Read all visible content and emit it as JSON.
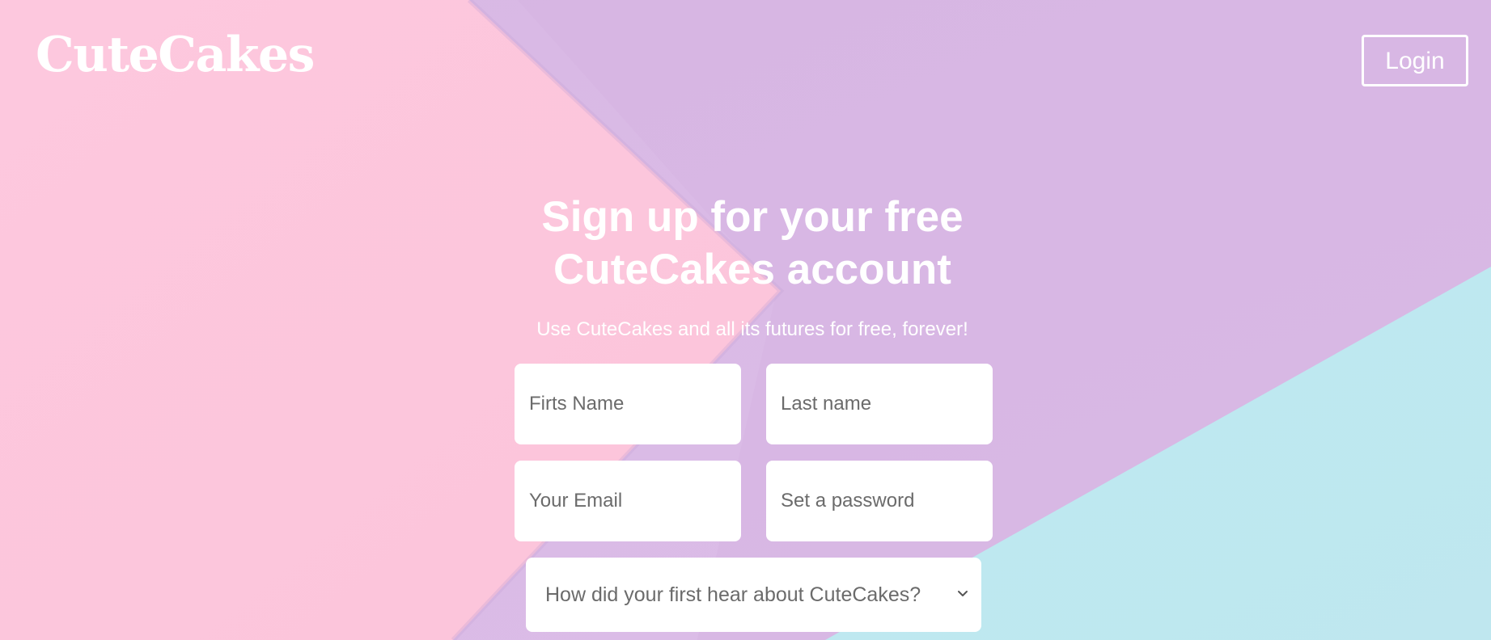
{
  "brand": {
    "logo_text": "CuteCakes"
  },
  "header": {
    "login_label": "Login"
  },
  "hero": {
    "headline": "Sign up for your free CuteCakes account",
    "subtitle": "Use CuteCakes and all its futures for free, forever!"
  },
  "form": {
    "first_name": {
      "placeholder": "Firts Name",
      "value": ""
    },
    "last_name": {
      "placeholder": "Last name",
      "value": ""
    },
    "email": {
      "placeholder": "Your Email",
      "value": ""
    },
    "password": {
      "placeholder": "Set a password",
      "value": ""
    },
    "referral_select": {
      "selected": "How did your first hear about CuteCakes?"
    }
  },
  "icons": {
    "select_chevron": "chevron-down-icon"
  },
  "colors": {
    "background_pink": "#fec6dd",
    "background_lavender": "#dbbde6",
    "background_aqua": "#bde8ef",
    "text_white": "#ffffff",
    "placeholder_gray": "#6b6b6b"
  }
}
